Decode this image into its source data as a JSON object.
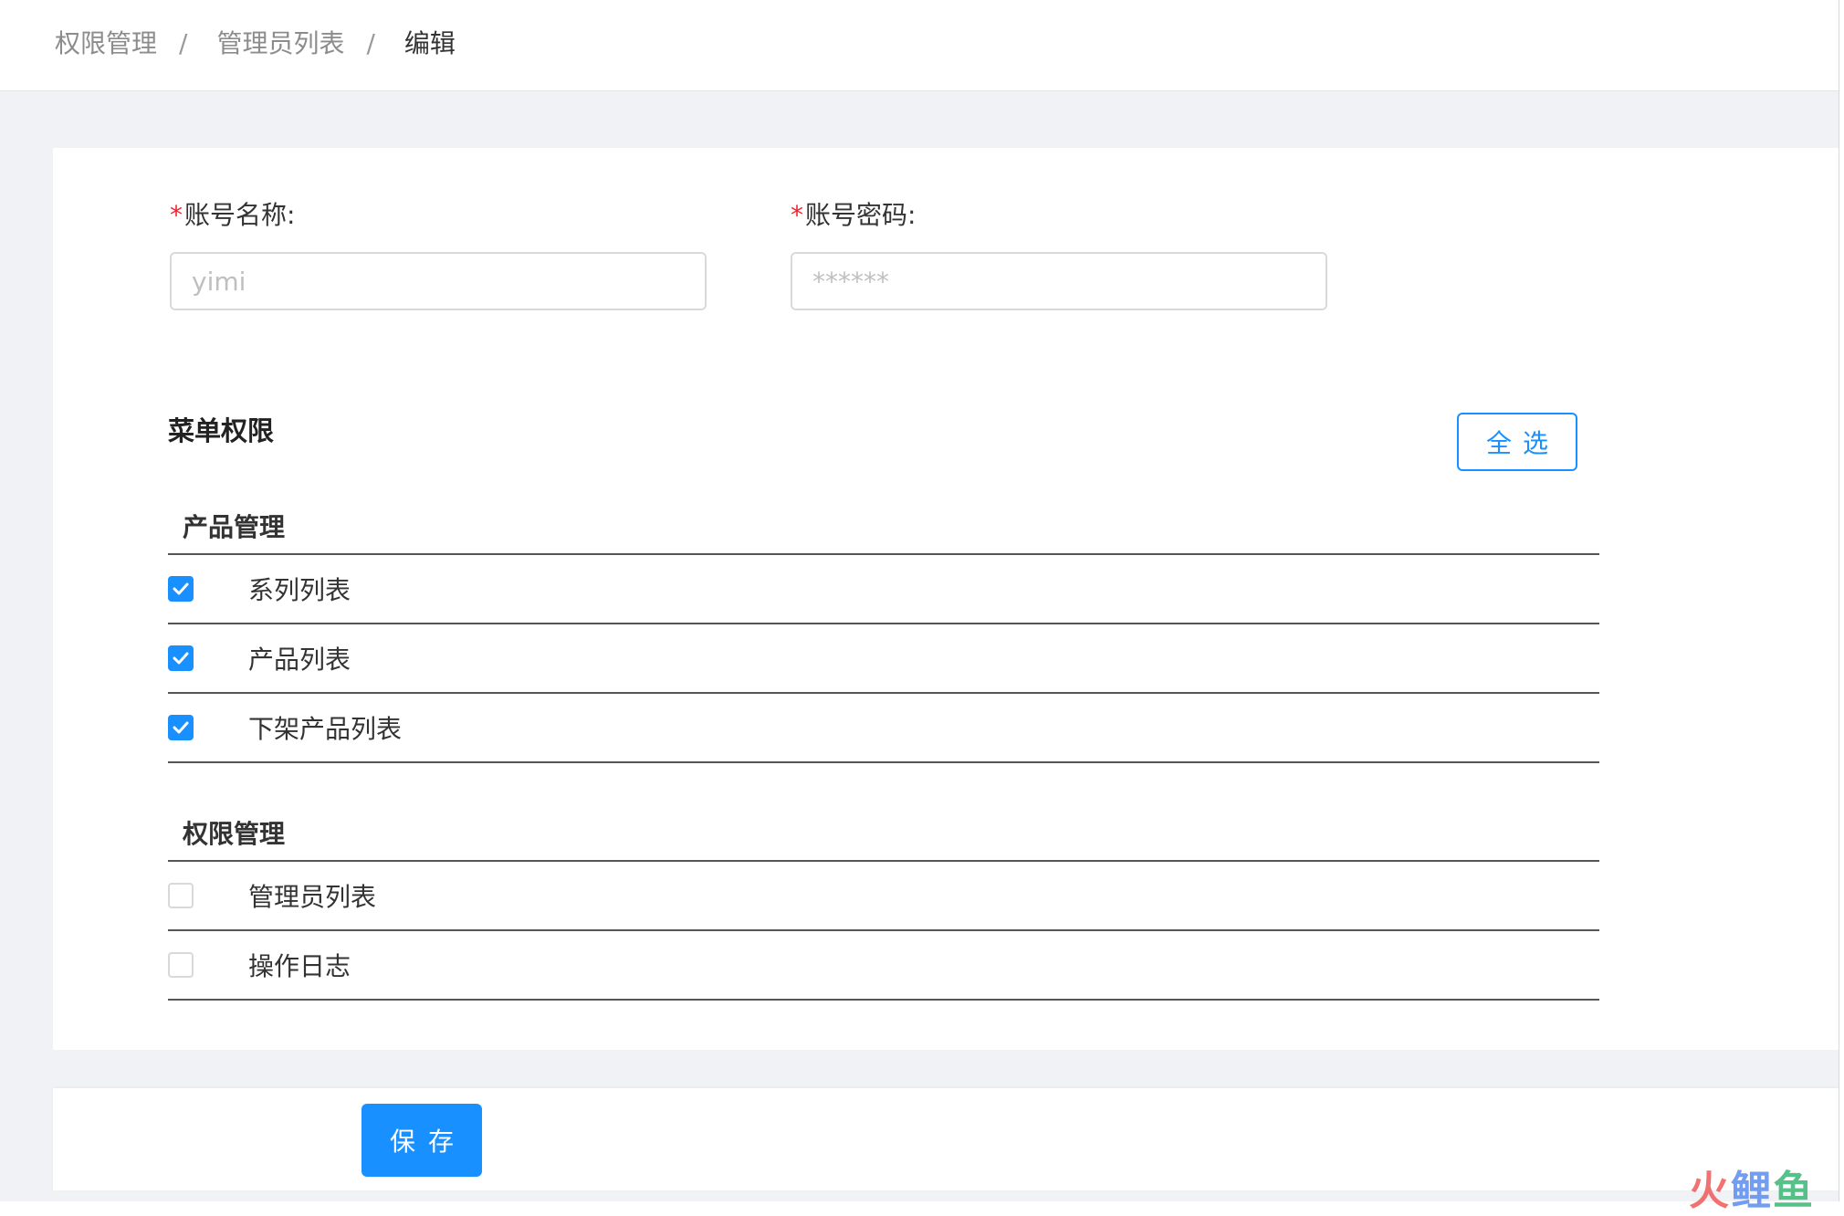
{
  "breadcrumb": {
    "items": [
      "权限管理",
      "管理员列表",
      "编辑"
    ],
    "separator": "/"
  },
  "form": {
    "account_name": {
      "required_mark": "*",
      "label": "账号名称:",
      "value": "",
      "placeholder": "yimi"
    },
    "account_password": {
      "required_mark": "*",
      "label": "账号密码:",
      "value": "",
      "placeholder": "******"
    }
  },
  "menu_permissions": {
    "title": "菜单权限",
    "select_all_label": "全选",
    "groups": [
      {
        "title": "产品管理",
        "items": [
          {
            "label": "系列列表",
            "checked": true
          },
          {
            "label": "产品列表",
            "checked": true
          },
          {
            "label": "下架产品列表",
            "checked": true
          }
        ]
      },
      {
        "title": "权限管理",
        "items": [
          {
            "label": "管理员列表",
            "checked": false
          },
          {
            "label": "操作日志",
            "checked": false
          }
        ]
      }
    ]
  },
  "footer": {
    "save_label": "保存"
  },
  "watermark": {
    "chars": [
      "火",
      "鲤",
      "鱼"
    ]
  },
  "colors": {
    "primary": "#1890ff",
    "required": "#f5222d",
    "background": "#f0f2f5"
  }
}
